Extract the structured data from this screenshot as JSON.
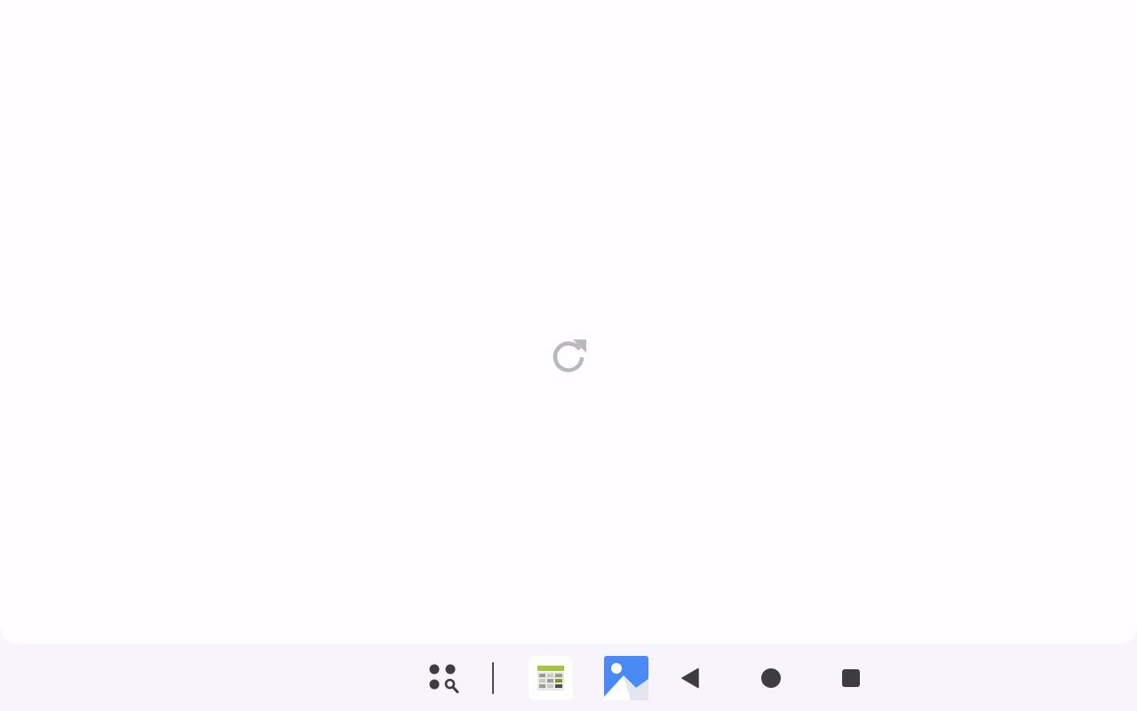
{
  "app": {
    "state": "loading",
    "reload_icon": "refresh-icon"
  },
  "taskbar": {
    "launcher_icon": "app-launcher-search-icon",
    "pinned_apps": [
      {
        "icon": "spreadsheet-app-icon"
      },
      {
        "icon": "gallery-app-icon"
      }
    ],
    "nav": {
      "back_icon": "back-triangle-icon",
      "home_icon": "home-circle-icon",
      "recents_icon": "recents-square-icon"
    }
  },
  "colors": {
    "surface": "#fffdff",
    "taskbar": "#f7f4fb",
    "reload_icon": "#b9b8bf",
    "nav_icon": "#3c3c41",
    "gallery_blue": "#4a8af4",
    "sheets_green": "#a4c639"
  }
}
